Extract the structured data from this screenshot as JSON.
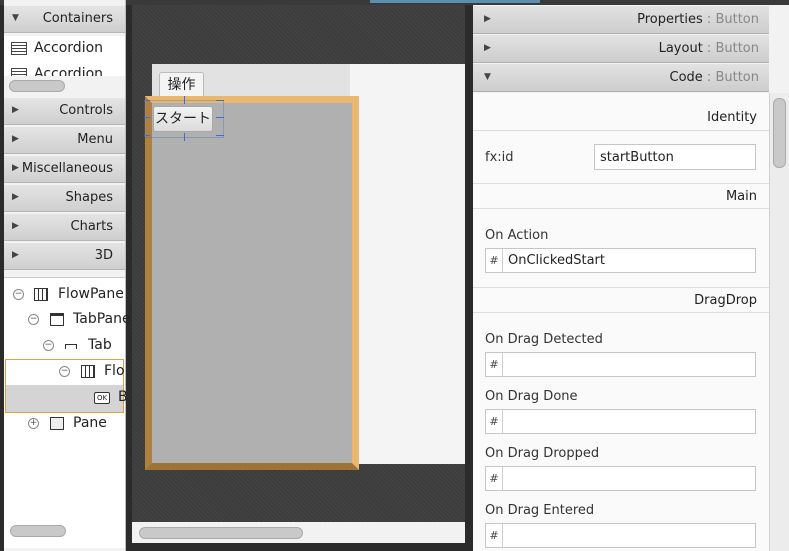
{
  "library": {
    "containers_label": "Containers",
    "items": [
      "Accordion",
      "Accordion"
    ],
    "sections": [
      "Controls",
      "Menu",
      "Miscellaneous",
      "Shapes",
      "Charts",
      "3D"
    ]
  },
  "hierarchy": {
    "nodes": [
      {
        "label": "FlowPane",
        "toggle": "−"
      },
      {
        "label": "TabPane",
        "toggle": "−"
      },
      {
        "label": "Tab",
        "toggle": "−"
      },
      {
        "label": "Flo",
        "toggle": "−"
      },
      {
        "label": "B",
        "badge": "OK"
      },
      {
        "label": "Pane",
        "toggle": "+"
      }
    ]
  },
  "canvas": {
    "tab_label": "操作",
    "button_label": "スタート"
  },
  "inspector": {
    "panels": [
      {
        "title": "Properties",
        "sub": "Button"
      },
      {
        "title": "Layout",
        "sub": "Button"
      },
      {
        "title": "Code",
        "sub": "Button"
      }
    ],
    "separator": " : ",
    "identity_section": "Identity",
    "fxid_label": "fx:id",
    "fxid_value": "startButton",
    "main_section": "Main",
    "on_action_label": "On Action",
    "on_action_value": "OnClickedStart",
    "dragdrop_section": "DragDrop",
    "hash": "#",
    "drag_events": [
      "On Drag Detected",
      "On Drag Done",
      "On Drag Dropped",
      "On Drag Entered"
    ]
  }
}
